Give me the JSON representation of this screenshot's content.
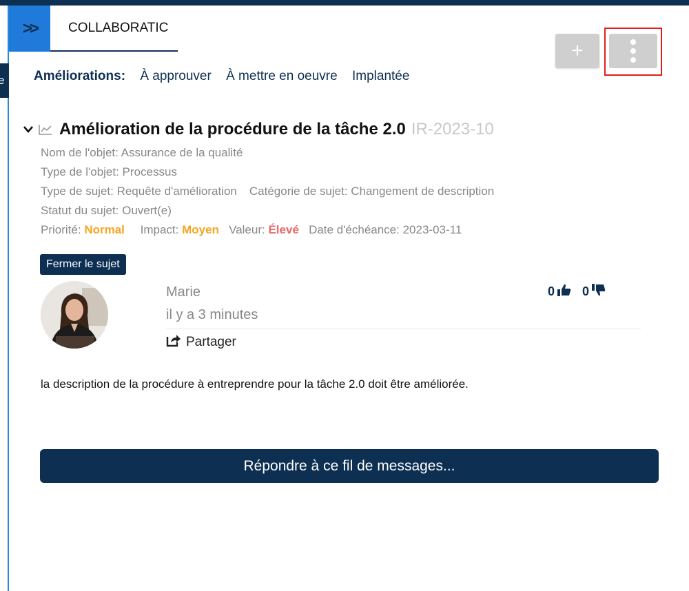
{
  "header": {
    "edge_letter": "e",
    "expand_icon": "double-chevron-right-icon",
    "tab_label": "COLLABORATIC",
    "add_label": "+",
    "more_icon": "vertical-dots-icon"
  },
  "filters": {
    "label": "Améliorations:",
    "items": [
      "À approuver",
      "À mettre en oeuvre",
      "Implantée"
    ]
  },
  "topic": {
    "title": "Amélioration de la procédure de la tâche 2.0",
    "ref": "IR-2023-10",
    "object_name": "Nom de l'objet: Assurance de la qualité",
    "object_type": "Type de l'objet: Processus",
    "subject_type": "Type de sujet: Requête d'amélioration",
    "subject_category": "Catégorie de sujet: Changement de description",
    "status": "Statut du sujet: Ouvert(e)",
    "priority_label": "Priorité:",
    "priority_value": "Normal",
    "impact_label": "Impact:",
    "impact_value": "Moyen",
    "value_label": "Valeur:",
    "value_value": "Élevé",
    "due_date": "Date d'échéance: 2023-03-11"
  },
  "tooltip": "Fermer le sujet",
  "post": {
    "author": "Marie",
    "time": "il y a 3 minutes",
    "share_label": "Partager",
    "likes": "0",
    "dislikes": "0",
    "body": "la description de la procédure à entreprendre pour la tâche 2.0 doit être améliorée."
  },
  "reply_label": "Répondre à ce fil de messages...",
  "colors": {
    "navy": "#0d2f52",
    "blue": "#1f7ad9",
    "orange": "#f5a623",
    "red": "#e86a6a",
    "highlight": "#e11c1c"
  }
}
